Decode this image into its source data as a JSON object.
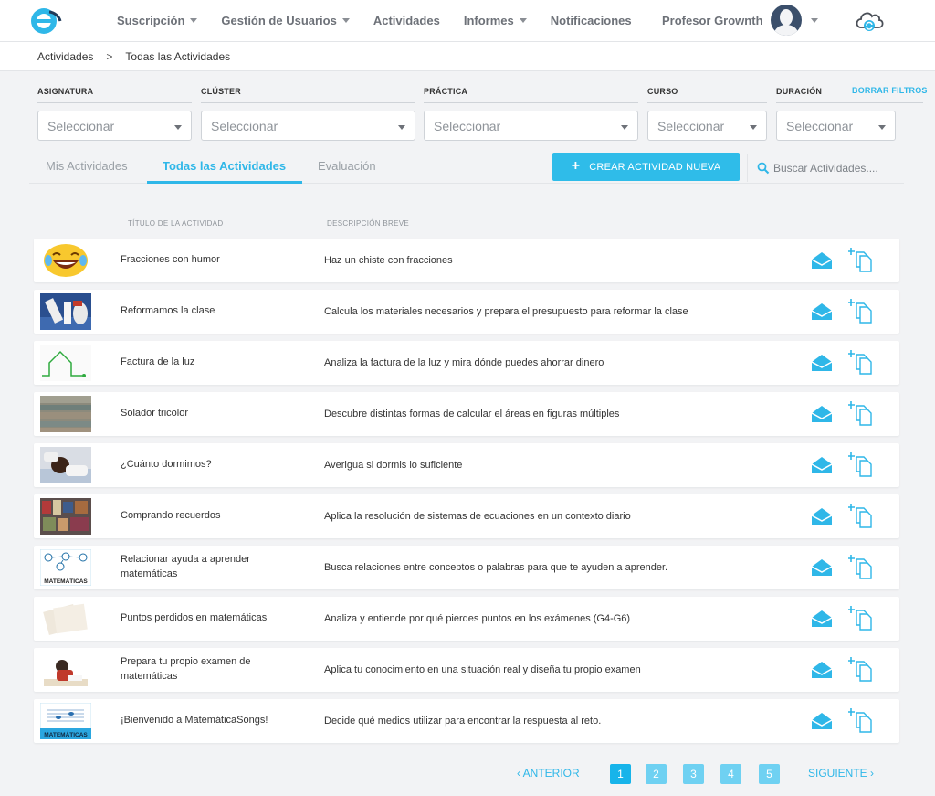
{
  "nav": {
    "items": [
      {
        "label": "Suscripción",
        "dropdown": true
      },
      {
        "label": "Gestión de Usuarios",
        "dropdown": true
      },
      {
        "label": "Actividades",
        "dropdown": false
      },
      {
        "label": "Informes",
        "dropdown": true
      },
      {
        "label": "Notificaciones",
        "dropdown": false
      }
    ],
    "user_name": "Profesor Grownth"
  },
  "breadcrumb": {
    "items": [
      "Actividades",
      "Todas las Actividades"
    ],
    "separator": ">"
  },
  "filters": {
    "items": [
      {
        "label": "ASIGNATURA",
        "value": "Seleccionar"
      },
      {
        "label": "CLÚSTER",
        "value": "Seleccionar"
      },
      {
        "label": "PRÁCTICA",
        "value": "Seleccionar"
      },
      {
        "label": "CURSO",
        "value": "Seleccionar"
      },
      {
        "label": "DURACIÓN",
        "value": "Seleccionar"
      }
    ],
    "clear_label": "BORRAR FILTROS"
  },
  "tabs": [
    {
      "label": "Mis Actividades",
      "active": false
    },
    {
      "label": "Todas las Actividades",
      "active": true
    },
    {
      "label": "Evaluación",
      "active": false
    }
  ],
  "create_button": {
    "icon": "+",
    "label": "CREAR ACTIVIDAD NUEVA"
  },
  "search": {
    "placeholder": "Buscar Actividades...."
  },
  "table": {
    "columns": [
      "TÍTULO DE LA ACTIVIDAD",
      "DESCRIPCIÓN BREVE"
    ],
    "rows": [
      {
        "title": "Fracciones con humor",
        "description": "Haz un chiste con fracciones",
        "thumb": "laughing-emoji"
      },
      {
        "title": "Reformamos la clase",
        "description": "Calcula los materiales necesarios y prepara el presupuesto para reformar la clase",
        "thumb": "paint-supplies"
      },
      {
        "title": "Factura de la luz",
        "description": "Analiza la factura de la luz y mira dónde puedes ahorrar dinero",
        "thumb": "house-plug"
      },
      {
        "title": "Solador tricolor",
        "description": "Descubre distintas formas de calcular el áreas en figuras múltiples",
        "thumb": "tiles"
      },
      {
        "title": "¿Cuánto dormimos?",
        "description": "Averigua si dormis lo suficiente",
        "thumb": "sleeping-child"
      },
      {
        "title": "Comprando recuerdos",
        "description": "Aplica la resolución de sistemas de ecuaciones en un contexto diario",
        "thumb": "souvenirs"
      },
      {
        "title": "Relacionar ayuda a aprender matemáticas",
        "description": "Busca relaciones entre conceptos o palabras para que te ayuden a aprender.",
        "thumb": "matematicas-diagram",
        "thumb_text": "MATEMÁTICAS"
      },
      {
        "title": "Puntos perdidos en matemáticas",
        "description": "Analiza y entiende por qué pierdes puntos en los exámenes (G4-G6)",
        "thumb": "exam-papers"
      },
      {
        "title": "Prepara tu propio examen de matemáticas",
        "description": "Aplica tu conocimiento en una situación real y diseña tu propio examen",
        "thumb": "student-studying"
      },
      {
        "title": "¡Bienvenido a MatemáticaSongs!",
        "description": "Decide qué medios utilizar para encontrar la respuesta al reto.",
        "thumb": "matematicas-songs",
        "thumb_text": "MATEMÁTICAS"
      }
    ]
  },
  "pagination": {
    "prev_label": "ANTERIOR",
    "next_label": "SIGUIENTE",
    "pages": [
      "1",
      "2",
      "3",
      "4",
      "5"
    ],
    "current": "1"
  },
  "colors": {
    "accent": "#2fb7e8",
    "page_background": "#f2f3f5",
    "nav_text": "#6d7178"
  }
}
